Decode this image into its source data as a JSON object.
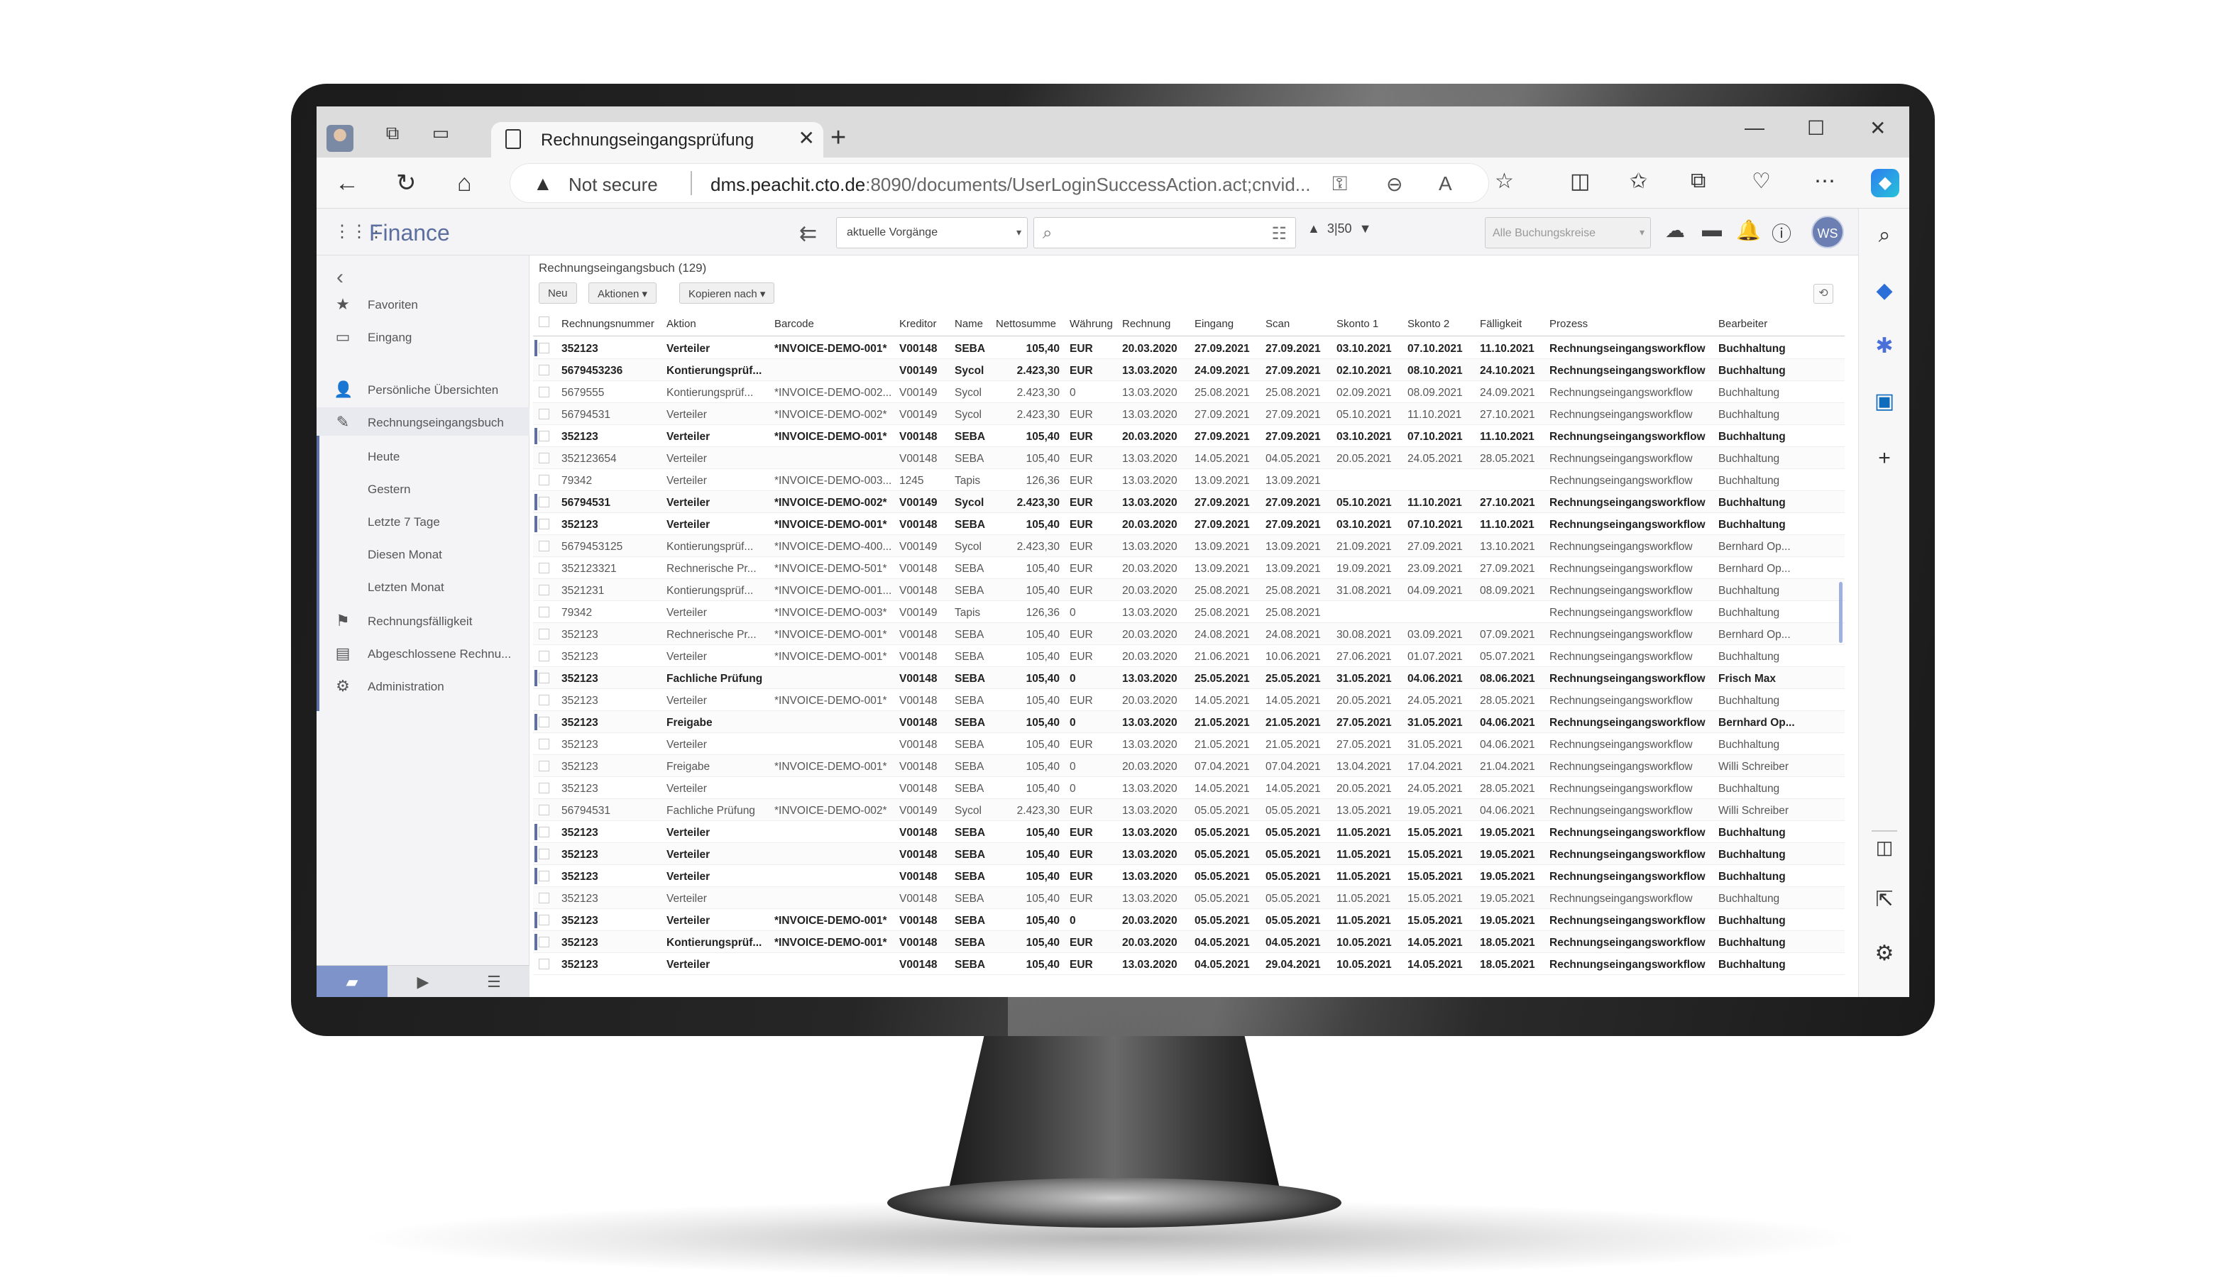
{
  "browser": {
    "tab_title": "Rechnungseingangsprüfung",
    "security": "Not secure",
    "url_host": "dms.peachit.cto.de",
    "url_rest": ":8090/documents/UserLoginSuccessAction.act;cnvid..."
  },
  "app": {
    "title": "Finance",
    "filter_select": "aktuelle Vorgänge",
    "pager": "3|50",
    "company_select": "Alle Buchungskreise",
    "user_initials": "WS"
  },
  "sidebar": {
    "items": [
      {
        "icon": "star-icon",
        "label": "Favoriten"
      },
      {
        "icon": "inbox-icon",
        "label": "Eingang"
      },
      {
        "icon": "person-icon",
        "label": "Persönliche Übersichten"
      },
      {
        "icon": "invoice-book-icon",
        "label": "Rechnungseingangsbuch"
      },
      {
        "icon": "",
        "label": "Heute"
      },
      {
        "icon": "",
        "label": "Gestern"
      },
      {
        "icon": "",
        "label": "Letzte 7 Tage"
      },
      {
        "icon": "",
        "label": "Diesen Monat"
      },
      {
        "icon": "",
        "label": "Letzten Monat"
      },
      {
        "icon": "due-icon",
        "label": "Rechnungsfälligkeit"
      },
      {
        "icon": "archive-icon",
        "label": "Abgeschlossene Rechnu..."
      },
      {
        "icon": "gear-icon",
        "label": "Administration"
      }
    ]
  },
  "main": {
    "breadcrumb": "Rechnungseingangsbuch (129)",
    "buttons": {
      "new": "Neu",
      "actions": "Aktionen",
      "copy": "Kopieren nach"
    },
    "columns": [
      "Rechnungsnummer",
      "Aktion",
      "Barcode",
      "Kreditor",
      "Name",
      "Nettosumme",
      "Währung",
      "Rechnung",
      "Eingang",
      "Scan",
      "Skonto 1",
      "Skonto 2",
      "Fälligkeit",
      "Prozess",
      "Bearbeiter"
    ],
    "rows": [
      {
        "b": 1,
        "m": 1,
        "c": [
          "352123",
          "Verteiler",
          "*INVOICE-DEMO-001*",
          "V00148",
          "SEBA",
          "105,40",
          "EUR",
          "20.03.2020",
          "27.09.2021",
          "27.09.2021",
          "03.10.2021",
          "07.10.2021",
          "11.10.2021",
          "Rechnungseingangsworkflow",
          "Buchhaltung"
        ]
      },
      {
        "b": 1,
        "m": 0,
        "c": [
          "5679453236",
          "Kontierungsprüf...",
          "",
          "V00149",
          "Sycol",
          "2.423,30",
          "EUR",
          "13.03.2020",
          "24.09.2021",
          "27.09.2021",
          "02.10.2021",
          "08.10.2021",
          "24.10.2021",
          "Rechnungseingangsworkflow",
          "Buchhaltung"
        ]
      },
      {
        "b": 0,
        "m": 0,
        "c": [
          "5679555",
          "Kontierungsprüf...",
          "*INVOICE-DEMO-002...",
          "V00149",
          "Sycol",
          "2.423,30",
          "0",
          "13.03.2020",
          "25.08.2021",
          "25.08.2021",
          "02.09.2021",
          "08.09.2021",
          "24.09.2021",
          "Rechnungseingangsworkflow",
          "Buchhaltung"
        ]
      },
      {
        "b": 0,
        "m": 0,
        "c": [
          "56794531",
          "Verteiler",
          "*INVOICE-DEMO-002*",
          "V00149",
          "Sycol",
          "2.423,30",
          "EUR",
          "13.03.2020",
          "27.09.2021",
          "27.09.2021",
          "05.10.2021",
          "11.10.2021",
          "27.10.2021",
          "Rechnungseingangsworkflow",
          "Buchhaltung"
        ]
      },
      {
        "b": 1,
        "m": 1,
        "c": [
          "352123",
          "Verteiler",
          "*INVOICE-DEMO-001*",
          "V00148",
          "SEBA",
          "105,40",
          "EUR",
          "20.03.2020",
          "27.09.2021",
          "27.09.2021",
          "03.10.2021",
          "07.10.2021",
          "11.10.2021",
          "Rechnungseingangsworkflow",
          "Buchhaltung"
        ]
      },
      {
        "b": 0,
        "m": 0,
        "c": [
          "352123654",
          "Verteiler",
          "",
          "V00148",
          "SEBA",
          "105,40",
          "EUR",
          "13.03.2020",
          "14.05.2021",
          "04.05.2021",
          "20.05.2021",
          "24.05.2021",
          "28.05.2021",
          "Rechnungseingangsworkflow",
          "Buchhaltung"
        ]
      },
      {
        "b": 0,
        "m": 0,
        "c": [
          "79342",
          "Verteiler",
          "*INVOICE-DEMO-003...",
          "1245",
          "Tapis",
          "126,36",
          "EUR",
          "13.03.2020",
          "13.09.2021",
          "13.09.2021",
          "",
          "",
          "",
          "Rechnungseingangsworkflow",
          "Buchhaltung"
        ]
      },
      {
        "b": 1,
        "m": 1,
        "c": [
          "56794531",
          "Verteiler",
          "*INVOICE-DEMO-002*",
          "V00149",
          "Sycol",
          "2.423,30",
          "EUR",
          "13.03.2020",
          "27.09.2021",
          "27.09.2021",
          "05.10.2021",
          "11.10.2021",
          "27.10.2021",
          "Rechnungseingangsworkflow",
          "Buchhaltung"
        ]
      },
      {
        "b": 1,
        "m": 1,
        "c": [
          "352123",
          "Verteiler",
          "*INVOICE-DEMO-001*",
          "V00148",
          "SEBA",
          "105,40",
          "EUR",
          "20.03.2020",
          "27.09.2021",
          "27.09.2021",
          "03.10.2021",
          "07.10.2021",
          "11.10.2021",
          "Rechnungseingangsworkflow",
          "Buchhaltung"
        ]
      },
      {
        "b": 0,
        "m": 0,
        "c": [
          "5679453125",
          "Kontierungsprüf...",
          "*INVOICE-DEMO-400...",
          "V00149",
          "Sycol",
          "2.423,30",
          "EUR",
          "13.03.2020",
          "13.09.2021",
          "13.09.2021",
          "21.09.2021",
          "27.09.2021",
          "13.10.2021",
          "Rechnungseingangsworkflow",
          "Bernhard Op..."
        ]
      },
      {
        "b": 0,
        "m": 0,
        "c": [
          "352123321",
          "Rechnerische Pr...",
          "*INVOICE-DEMO-501*",
          "V00148",
          "SEBA",
          "105,40",
          "EUR",
          "20.03.2020",
          "13.09.2021",
          "13.09.2021",
          "19.09.2021",
          "23.09.2021",
          "27.09.2021",
          "Rechnungseingangsworkflow",
          "Bernhard Op..."
        ]
      },
      {
        "b": 0,
        "m": 0,
        "c": [
          "3521231",
          "Kontierungsprüf...",
          "*INVOICE-DEMO-001...",
          "V00148",
          "SEBA",
          "105,40",
          "EUR",
          "20.03.2020",
          "25.08.2021",
          "25.08.2021",
          "31.08.2021",
          "04.09.2021",
          "08.09.2021",
          "Rechnungseingangsworkflow",
          "Buchhaltung"
        ]
      },
      {
        "b": 0,
        "m": 0,
        "c": [
          "79342",
          "Verteiler",
          "*INVOICE-DEMO-003*",
          "V00149",
          "Tapis",
          "126,36",
          "0",
          "13.03.2020",
          "25.08.2021",
          "25.08.2021",
          "",
          "",
          "",
          "Rechnungseingangsworkflow",
          "Buchhaltung"
        ]
      },
      {
        "b": 0,
        "m": 0,
        "c": [
          "352123",
          "Rechnerische Pr...",
          "*INVOICE-DEMO-001*",
          "V00148",
          "SEBA",
          "105,40",
          "EUR",
          "20.03.2020",
          "24.08.2021",
          "24.08.2021",
          "30.08.2021",
          "03.09.2021",
          "07.09.2021",
          "Rechnungseingangsworkflow",
          "Bernhard Op..."
        ]
      },
      {
        "b": 0,
        "m": 0,
        "c": [
          "352123",
          "Verteiler",
          "*INVOICE-DEMO-001*",
          "V00148",
          "SEBA",
          "105,40",
          "EUR",
          "20.03.2020",
          "21.06.2021",
          "10.06.2021",
          "27.06.2021",
          "01.07.2021",
          "05.07.2021",
          "Rechnungseingangsworkflow",
          "Buchhaltung"
        ]
      },
      {
        "b": 1,
        "m": 1,
        "c": [
          "352123",
          "Fachliche Prüfung",
          "",
          "V00148",
          "SEBA",
          "105,40",
          "0",
          "13.03.2020",
          "25.05.2021",
          "25.05.2021",
          "31.05.2021",
          "04.06.2021",
          "08.06.2021",
          "Rechnungseingangsworkflow",
          "Frisch Max"
        ]
      },
      {
        "b": 0,
        "m": 0,
        "c": [
          "352123",
          "Verteiler",
          "*INVOICE-DEMO-001*",
          "V00148",
          "SEBA",
          "105,40",
          "EUR",
          "20.03.2020",
          "14.05.2021",
          "14.05.2021",
          "20.05.2021",
          "24.05.2021",
          "28.05.2021",
          "Rechnungseingangsworkflow",
          "Buchhaltung"
        ]
      },
      {
        "b": 1,
        "m": 1,
        "c": [
          "352123",
          "Freigabe",
          "",
          "V00148",
          "SEBA",
          "105,40",
          "0",
          "13.03.2020",
          "21.05.2021",
          "21.05.2021",
          "27.05.2021",
          "31.05.2021",
          "04.06.2021",
          "Rechnungseingangsworkflow",
          "Bernhard Op..."
        ]
      },
      {
        "b": 0,
        "m": 0,
        "c": [
          "352123",
          "Verteiler",
          "",
          "V00148",
          "SEBA",
          "105,40",
          "EUR",
          "13.03.2020",
          "21.05.2021",
          "21.05.2021",
          "27.05.2021",
          "31.05.2021",
          "04.06.2021",
          "Rechnungseingangsworkflow",
          "Buchhaltung"
        ]
      },
      {
        "b": 0,
        "m": 0,
        "c": [
          "352123",
          "Freigabe",
          "*INVOICE-DEMO-001*",
          "V00148",
          "SEBA",
          "105,40",
          "0",
          "20.03.2020",
          "07.04.2021",
          "07.04.2021",
          "13.04.2021",
          "17.04.2021",
          "21.04.2021",
          "Rechnungseingangsworkflow",
          "Willi Schreiber"
        ]
      },
      {
        "b": 0,
        "m": 0,
        "c": [
          "352123",
          "Verteiler",
          "",
          "V00148",
          "SEBA",
          "105,40",
          "0",
          "13.03.2020",
          "14.05.2021",
          "14.05.2021",
          "20.05.2021",
          "24.05.2021",
          "28.05.2021",
          "Rechnungseingangsworkflow",
          "Buchhaltung"
        ]
      },
      {
        "b": 0,
        "m": 0,
        "c": [
          "56794531",
          "Fachliche Prüfung",
          "*INVOICE-DEMO-002*",
          "V00149",
          "Sycol",
          "2.423,30",
          "EUR",
          "13.03.2020",
          "05.05.2021",
          "05.05.2021",
          "13.05.2021",
          "19.05.2021",
          "04.06.2021",
          "Rechnungseingangsworkflow",
          "Willi Schreiber"
        ]
      },
      {
        "b": 1,
        "m": 1,
        "c": [
          "352123",
          "Verteiler",
          "",
          "V00148",
          "SEBA",
          "105,40",
          "EUR",
          "13.03.2020",
          "05.05.2021",
          "05.05.2021",
          "11.05.2021",
          "15.05.2021",
          "19.05.2021",
          "Rechnungseingangsworkflow",
          "Buchhaltung"
        ]
      },
      {
        "b": 1,
        "m": 1,
        "c": [
          "352123",
          "Verteiler",
          "",
          "V00148",
          "SEBA",
          "105,40",
          "EUR",
          "13.03.2020",
          "05.05.2021",
          "05.05.2021",
          "11.05.2021",
          "15.05.2021",
          "19.05.2021",
          "Rechnungseingangsworkflow",
          "Buchhaltung"
        ]
      },
      {
        "b": 1,
        "m": 1,
        "c": [
          "352123",
          "Verteiler",
          "",
          "V00148",
          "SEBA",
          "105,40",
          "EUR",
          "13.03.2020",
          "05.05.2021",
          "05.05.2021",
          "11.05.2021",
          "15.05.2021",
          "19.05.2021",
          "Rechnungseingangsworkflow",
          "Buchhaltung"
        ]
      },
      {
        "b": 0,
        "m": 0,
        "c": [
          "352123",
          "Verteiler",
          "",
          "V00148",
          "SEBA",
          "105,40",
          "EUR",
          "13.03.2020",
          "05.05.2021",
          "05.05.2021",
          "11.05.2021",
          "15.05.2021",
          "19.05.2021",
          "Rechnungseingangsworkflow",
          "Buchhaltung"
        ]
      },
      {
        "b": 1,
        "m": 1,
        "c": [
          "352123",
          "Verteiler",
          "*INVOICE-DEMO-001*",
          "V00148",
          "SEBA",
          "105,40",
          "0",
          "20.03.2020",
          "05.05.2021",
          "05.05.2021",
          "11.05.2021",
          "15.05.2021",
          "19.05.2021",
          "Rechnungseingangsworkflow",
          "Buchhaltung"
        ]
      },
      {
        "b": 1,
        "m": 1,
        "c": [
          "352123",
          "Kontierungsprüf...",
          "*INVOICE-DEMO-001*",
          "V00148",
          "SEBA",
          "105,40",
          "EUR",
          "20.03.2020",
          "04.05.2021",
          "04.05.2021",
          "10.05.2021",
          "14.05.2021",
          "18.05.2021",
          "Rechnungseingangsworkflow",
          "Buchhaltung"
        ]
      },
      {
        "b": 1,
        "m": 0,
        "c": [
          "352123",
          "Verteiler",
          "",
          "V00148",
          "SEBA",
          "105,40",
          "EUR",
          "13.03.2020",
          "04.05.2021",
          "29.04.2021",
          "10.05.2021",
          "14.05.2021",
          "18.05.2021",
          "Rechnungseingangsworkflow",
          "Buchhaltung"
        ]
      }
    ]
  }
}
